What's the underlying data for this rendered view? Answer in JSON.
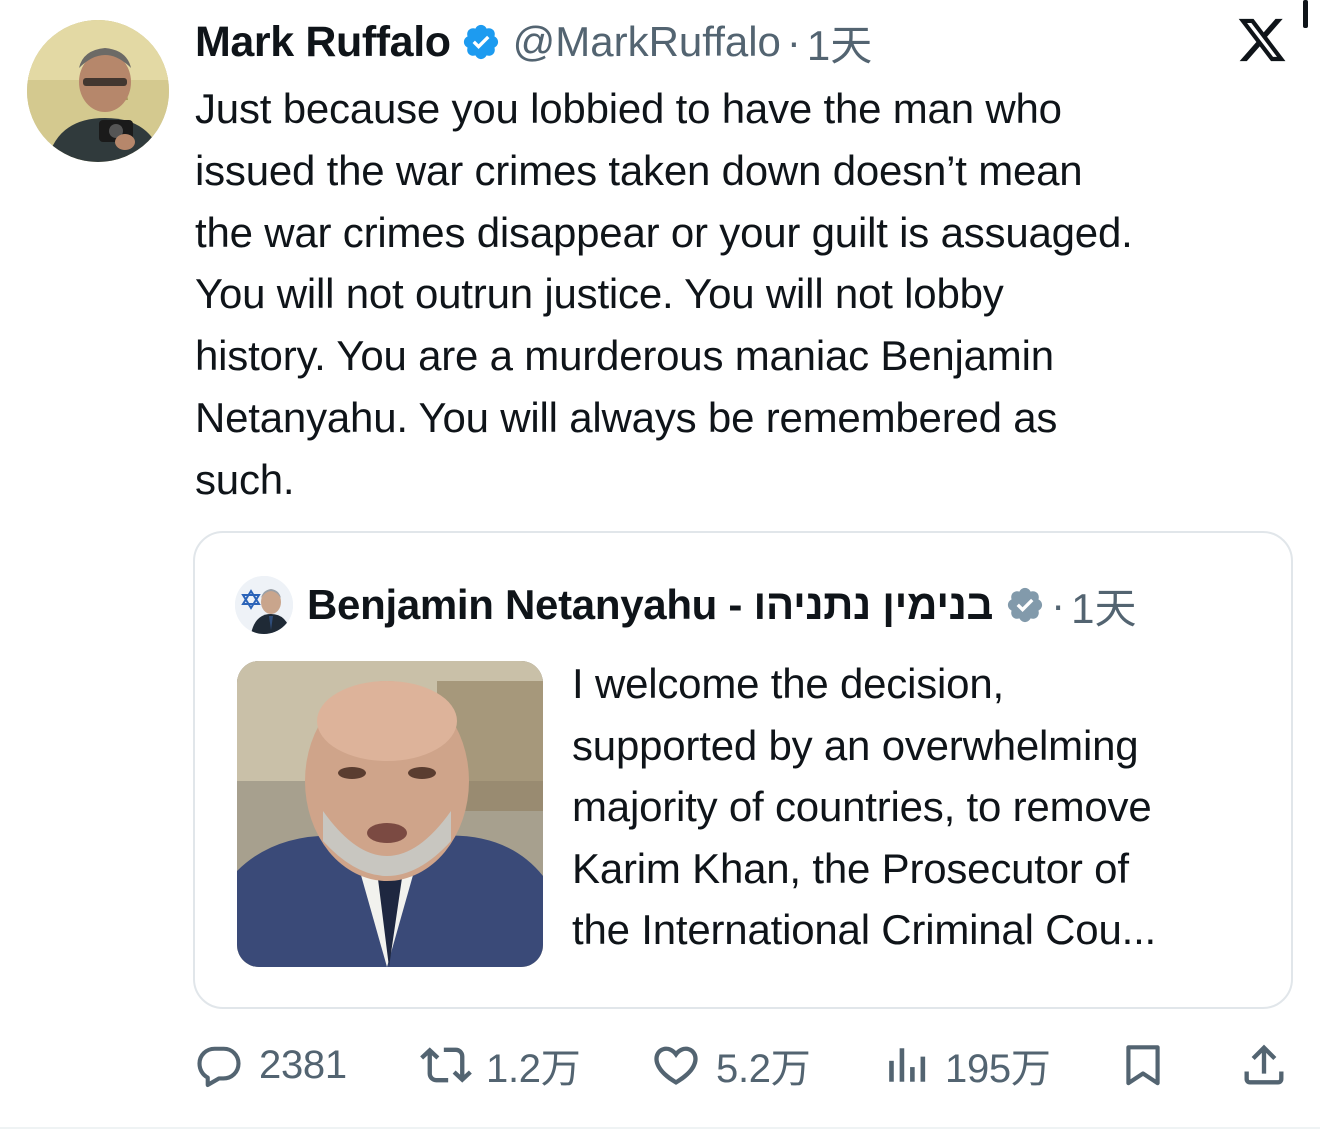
{
  "tweet": {
    "display_name": "Mark Ruffalo",
    "handle": "@MarkRuffalo",
    "separator": "·",
    "time": "1天",
    "text": "Just because you lobbied to have the man who\nissued the war crimes taken down doesn’t mean\nthe war crimes disappear or your guilt is assuaged.\nYou will not outrun justice. You will not lobby\nhistory. You are a murderous maniac Benjamin\nNetanyahu. You will always be remembered as\nsuch."
  },
  "quoted": {
    "display_name": "Benjamin Netanyahu - בנימין נתניהו",
    "separator": "·",
    "time": "1天",
    "text": "I welcome the decision,\nsupported by an overwhelming\nmajority of countries, to remove\nKarim Khan, the Prosecutor of\nthe International Criminal Cou..."
  },
  "actions": {
    "replies": "2381",
    "reposts": "1.2万",
    "likes": "5.2万",
    "views": "195万"
  },
  "icons": {
    "verified": "verified-badge-icon",
    "brand": "x-logo-icon",
    "reply": "reply-icon",
    "repost": "repost-icon",
    "like": "heart-icon",
    "views": "views-icon",
    "bookmark": "bookmark-icon",
    "share": "share-icon"
  },
  "colors": {
    "verified": "#1d9bf0",
    "quoted_verified": "#829aab",
    "secondary_text": "#536471",
    "border": "#e1e6ea"
  }
}
